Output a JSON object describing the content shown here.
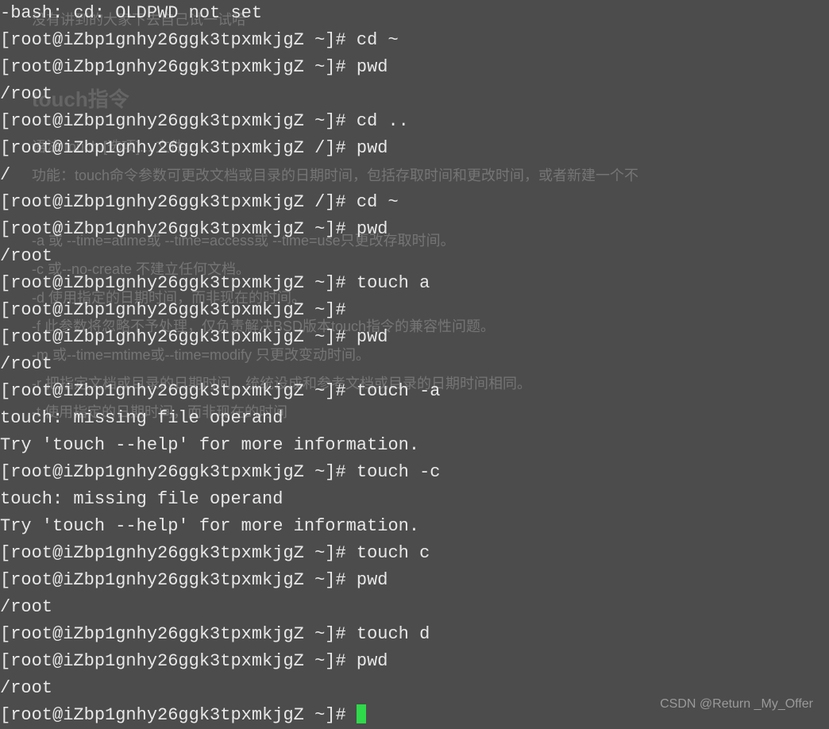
{
  "background": {
    "line1": "没有讲到的大家下去自己试一试哈",
    "heading": "touch指令",
    "syntax": "语法 touch [选项]... 文件...",
    "function": "功能：touch命令参数可更改文档或目录的日期时间，包括存取时间和更改时间，或者新建一个不",
    "opt_a": "-a 或 --time=atime或 --time=access或 --time=use只更改存取时间。",
    "opt_c": "-c 或--no-create 不建立任何文档。",
    "opt_d": "-d 使用指定的日期时间，而非现在的时间。",
    "opt_f": "-f 此参数将忽略不予处理，仅负责解决BSD版本touch指令的兼容性问题。",
    "opt_m": "-m 或--time=mtime或--time=modify 只更改变动时间。",
    "opt_r": "-r 把指定文档或目录的日期时间，统统设成和参考文档或目录的日期时间相同。",
    "opt_t": "-t 使用指定的日期时间，而非现在的时间"
  },
  "terminal": {
    "lines": [
      "-bash: cd: OLDPWD not set",
      "[root@iZbp1gnhy26ggk3tpxmkjgZ ~]# cd ~",
      "[root@iZbp1gnhy26ggk3tpxmkjgZ ~]# pwd",
      "/root",
      "[root@iZbp1gnhy26ggk3tpxmkjgZ ~]# cd ..",
      "[root@iZbp1gnhy26ggk3tpxmkjgZ /]# pwd",
      "/",
      "[root@iZbp1gnhy26ggk3tpxmkjgZ /]# cd ~",
      "[root@iZbp1gnhy26ggk3tpxmkjgZ ~]# pwd",
      "/root",
      "[root@iZbp1gnhy26ggk3tpxmkjgZ ~]# touch a",
      "[root@iZbp1gnhy26ggk3tpxmkjgZ ~]#",
      "[root@iZbp1gnhy26ggk3tpxmkjgZ ~]# pwd",
      "/root",
      "[root@iZbp1gnhy26ggk3tpxmkjgZ ~]# touch -a",
      "touch: missing file operand",
      "Try 'touch --help' for more information.",
      "[root@iZbp1gnhy26ggk3tpxmkjgZ ~]# touch -c",
      "touch: missing file operand",
      "Try 'touch --help' for more information.",
      "[root@iZbp1gnhy26ggk3tpxmkjgZ ~]# touch c",
      "[root@iZbp1gnhy26ggk3tpxmkjgZ ~]# pwd",
      "/root",
      "[root@iZbp1gnhy26ggk3tpxmkjgZ ~]# touch d",
      "[root@iZbp1gnhy26ggk3tpxmkjgZ ~]# pwd",
      "/root",
      "[root@iZbp1gnhy26ggk3tpxmkjgZ ~]# "
    ]
  },
  "watermark": "CSDN @Return _My_Offer"
}
